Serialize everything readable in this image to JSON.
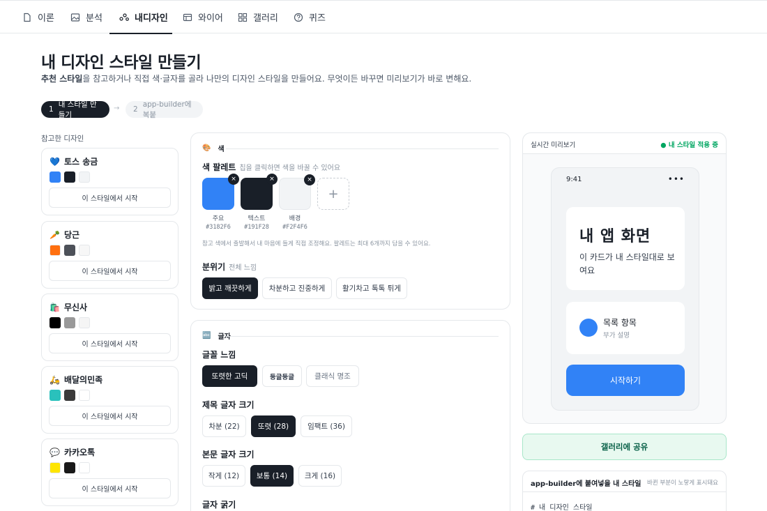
{
  "tabs": [
    {
      "label": "이론",
      "icon": "document-icon"
    },
    {
      "label": "분석",
      "icon": "image-icon"
    },
    {
      "label": "내디자인",
      "icon": "share-nodes-icon"
    },
    {
      "label": "와이어",
      "icon": "wireframe-icon"
    },
    {
      "label": "갤러리",
      "icon": "grid-icon"
    },
    {
      "label": "퀴즈",
      "icon": "question-icon"
    }
  ],
  "header": {
    "title": "내 디자인 스타일 만들기",
    "desc_bold": "추천 스타일",
    "desc_rest": "을 참고하거나 직접 색·글자를 골라 나만의 디자인 스타일을 만들어요. 무엇이든 바꾸면 미리보기가 바로 변해요."
  },
  "steps": [
    {
      "num": "1",
      "label": "내 스타일 만들기"
    },
    {
      "num": "2",
      "label": "app-builder에 복붙"
    }
  ],
  "refs": {
    "label": "참고한 디자인",
    "button_label": "이 스타일에서 시작",
    "items": [
      {
        "emoji": "💙",
        "name": "토스 송금",
        "colors": [
          "#3182F6",
          "#191F28",
          "#F2F4F6"
        ]
      },
      {
        "emoji": "🥕",
        "name": "당근",
        "colors": [
          "#FF6F0F",
          "#4D5159",
          "#F7F7F7"
        ]
      },
      {
        "emoji": "🛍️",
        "name": "무신사",
        "colors": [
          "#000000",
          "#999999",
          "#F5F5F5"
        ]
      },
      {
        "emoji": "🛵",
        "name": "배달의민족",
        "colors": [
          "#2AC1BC",
          "#3A3A3A",
          "#FFFFFF"
        ]
      },
      {
        "emoji": "💬",
        "name": "카카오톡",
        "colors": [
          "#FEE500",
          "#191919",
          "#FFFFFF"
        ]
      }
    ]
  },
  "color_panel": {
    "emoji": "🎨",
    "title": "색",
    "palette_label": "색 팔레트",
    "palette_sub": "칩을 클릭하면 색을 바꿀 수 있어요",
    "remove_glyph": "×",
    "add_glyph": "+",
    "chips": [
      {
        "name": "주요",
        "hex": "#3182F6"
      },
      {
        "name": "텍스트",
        "hex": "#191F28"
      },
      {
        "name": "배경",
        "hex": "#F2F4F6"
      }
    ],
    "hint": "참고 색에서 출발해서 내 마음에 들게 직접 조정해요. 팔레트는 최대 6개까지 담을 수 있어요.",
    "mood_label": "분위기",
    "mood_sub": "전체 느낌",
    "moods": [
      "밝고 깨끗하게",
      "차분하고 진중하게",
      "활기차고 톡톡 튀게"
    ]
  },
  "font_panel": {
    "emoji": "🔤",
    "title": "글자",
    "feel_label": "글꼴 느낌",
    "feels": [
      "또렷한 고딕",
      "둥글둥글",
      "클래식 명조"
    ],
    "heading_label": "제목 글자 크기",
    "headings": [
      "차분 (22)",
      "또렷 (28)",
      "임팩트 (36)"
    ],
    "body_label": "본문 글자 크기",
    "bodies": [
      "작게 (12)",
      "보통 (14)",
      "크게 (16)"
    ],
    "weight_label": "글자 굵기"
  },
  "preview": {
    "title": "실시간 미리보기",
    "status": "● 내 스타일 적용 중",
    "time": "9:41",
    "dots": "•••",
    "card_title": "내 앱 화면",
    "card_body": "이 카드가 내 스타일대로 보여요",
    "list_title": "목록 항목",
    "list_sub": "부가 설명",
    "cta": "시작하기"
  },
  "share_label": "갤러리에 공유",
  "code": {
    "title": "app-builder에 붙여넣을 내 스타일",
    "hint": "바뀐 부분이 노랗게 표시돼요",
    "first_line": "# 내 디자인 스타일"
  }
}
